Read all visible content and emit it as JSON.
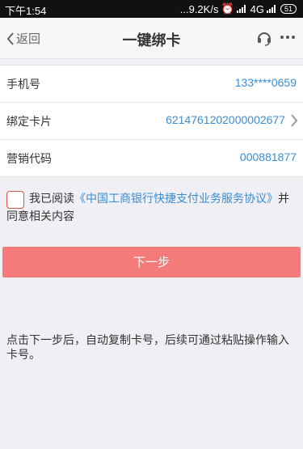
{
  "status_bar": {
    "time": "下午1:54",
    "net_speed": "...9.2K/s",
    "network": "4G",
    "battery": "51"
  },
  "nav": {
    "back_label": "返回",
    "title": "一键绑卡"
  },
  "form": {
    "rows": [
      {
        "label": "手机号",
        "value": "133****0659"
      },
      {
        "label": "绑定卡片",
        "value": "6214761202000002677"
      },
      {
        "label": "营销代码",
        "value": "000881877"
      }
    ]
  },
  "agreement": {
    "prefix": "我已阅读",
    "link": "《中国工商银行快捷支付业务服务协议》",
    "suffix": "并",
    "line2": "同意相关内容",
    "checked": false
  },
  "next_button": {
    "label": "下一步"
  },
  "tip": "点击下一步后，自动复制卡号，后续可通过粘贴操作输入卡号。",
  "colors": {
    "accent_link": "#3a8dd1",
    "button": "#f57b7b",
    "checkbox_border": "#d9534f"
  },
  "icons": [
    "back-chevron-icon",
    "headset-icon",
    "more-dots-icon",
    "chevron-right-icon",
    "alarm-icon",
    "signal-icon",
    "battery-icon"
  ]
}
